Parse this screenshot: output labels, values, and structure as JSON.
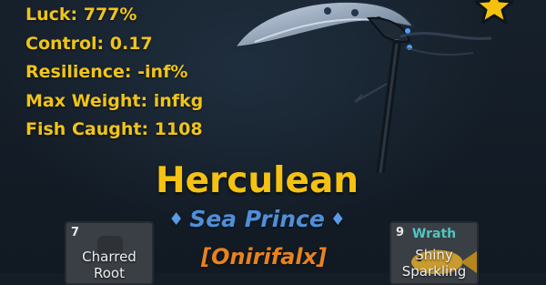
{
  "stats": [
    {
      "label": "Luck: 777%"
    },
    {
      "label": "Control: 0.17"
    },
    {
      "label": "Resilience: -inf%"
    },
    {
      "label": "Max Weight: infkg"
    },
    {
      "label": "Fish Caught: 1108"
    }
  ],
  "rod": {
    "name": "Herculean",
    "title": "Sea Prince",
    "title_decor_left": "♦",
    "title_decor_right": "♦",
    "player": "[Onirifalx]",
    "icon": "scythe-icon"
  },
  "inventory": [
    {
      "slot": "7",
      "name_line1": "Charred",
      "name_line2": "Root",
      "icon": "root-icon"
    },
    {
      "slot": "9",
      "mutation": "Wrath",
      "name_line1": "Shiny",
      "name_line2": "Sparkling",
      "icon": "fish-icon"
    }
  ],
  "colors": {
    "stat_text": "#f0c419",
    "rod_name": "#f5c211",
    "title": "#4f8fd8",
    "player": "#e8821f",
    "mutation": "#4fc6c0"
  },
  "favorite_icon": "star-icon"
}
